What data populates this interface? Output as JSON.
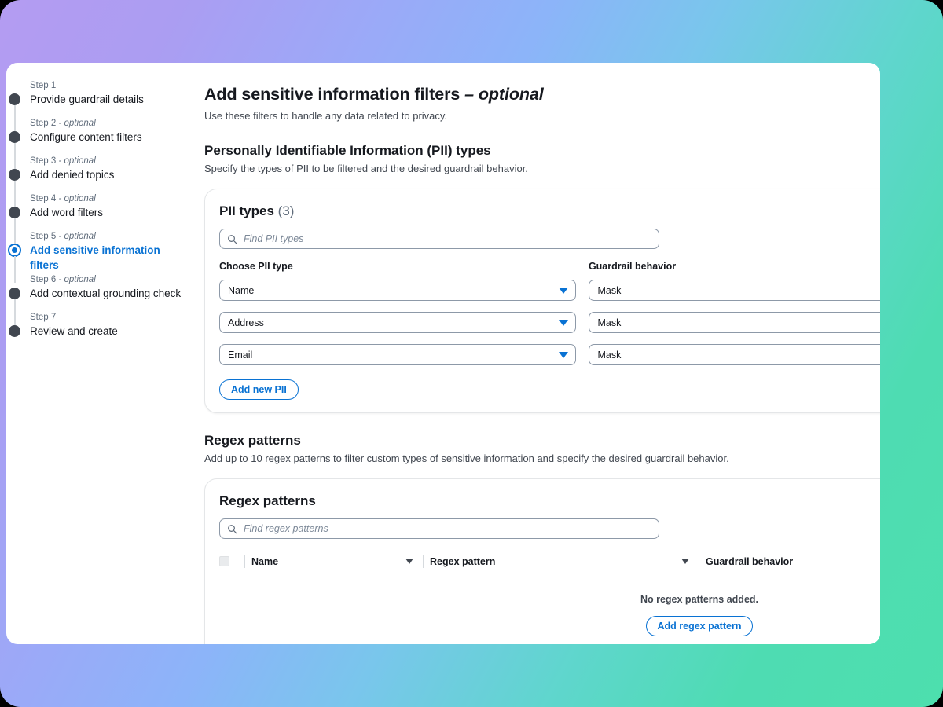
{
  "theme": {
    "accent_blue": "#0972d3",
    "text_dark": "#16191f",
    "text_muted": "#414750",
    "step_dot": "#414750",
    "gradient_purple": "#b49cf2",
    "gradient_blue": "#8dacfb",
    "gradient_green": "#4edcb2"
  },
  "sidebar": {
    "steps": [
      {
        "num": "Step 1",
        "optional": "",
        "label": "Provide guardrail details",
        "active": false
      },
      {
        "num": "Step 2",
        "optional": " - optional",
        "label": "Configure content filters",
        "active": false
      },
      {
        "num": "Step 3",
        "optional": " - optional",
        "label": "Add denied topics",
        "active": false
      },
      {
        "num": "Step 4",
        "optional": " - optional",
        "label": "Add word filters",
        "active": false
      },
      {
        "num": "Step 5",
        "optional": " - optional",
        "label": "Add sensitive information filters",
        "active": true
      },
      {
        "num": "Step 6",
        "optional": " - optional",
        "label": "Add contextual grounding check",
        "active": false
      },
      {
        "num": "Step 7",
        "optional": "",
        "label": "Review and create",
        "active": false
      }
    ]
  },
  "main": {
    "title": "Add sensitive information filters",
    "title_optional": "– optional",
    "description": "Use these filters to handle any data related to privacy.",
    "pii_section": {
      "heading": "Personally Identifiable Information (PII) types",
      "description": "Specify the types of PII to be filtered and the desired guardrail behavior.",
      "card_title": "PII types",
      "card_count": "(3)",
      "search_placeholder": "Find PII types",
      "search_value": "",
      "label_pii_type": "Choose PII type",
      "label_guardrail_behavior": "Guardrail behavior",
      "rows": [
        {
          "pii_type": "Name",
          "behavior": "Mask"
        },
        {
          "pii_type": "Address",
          "behavior": "Mask"
        },
        {
          "pii_type": "Email",
          "behavior": "Mask"
        }
      ],
      "add_button": "Add new PII"
    },
    "regex_section": {
      "heading": "Regex patterns",
      "description": "Add up to 10 regex patterns to filter custom types of sensitive information and specify the desired guardrail behavior.",
      "card_title": "Regex patterns",
      "search_placeholder": "Find regex patterns",
      "search_value": "",
      "columns": {
        "name": "Name",
        "regex_pattern": "Regex pattern",
        "guardrail_behavior": "Guardrail behavior"
      },
      "empty_text": "No regex patterns added.",
      "add_button": "Add regex pattern"
    }
  }
}
